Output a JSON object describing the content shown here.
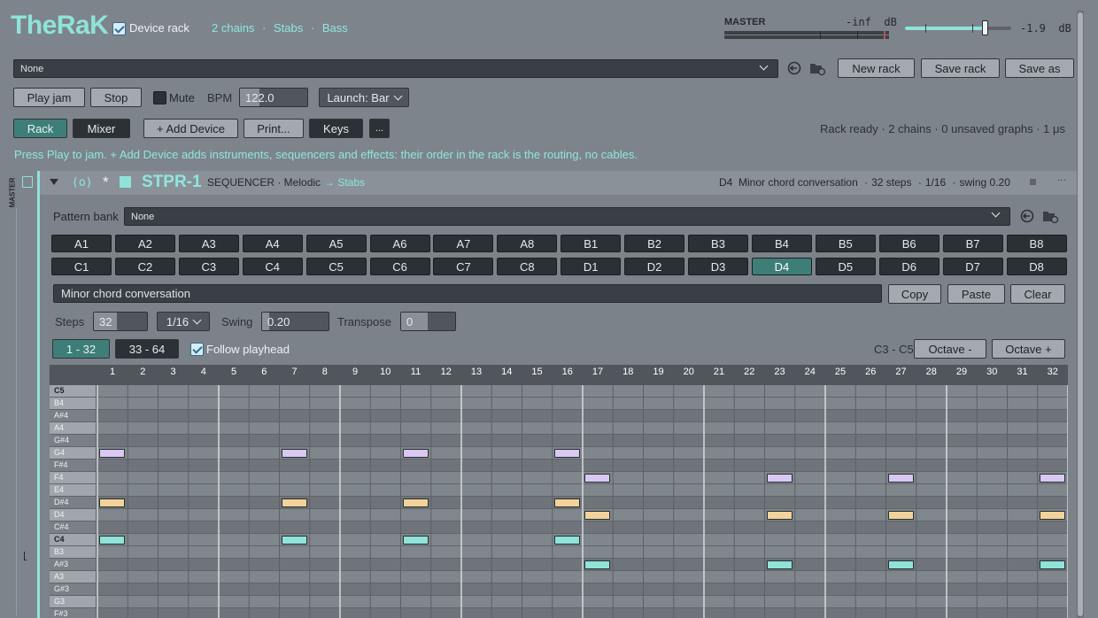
{
  "app": {
    "logo": "TheRaK",
    "device_rack_label": "Device rack",
    "device_rack_checked": true,
    "breadcrumb": [
      "2 chains",
      "Stabs",
      "Bass"
    ],
    "breadcrumb_sep": "·"
  },
  "master": {
    "label": "MASTER",
    "level_text": "-inf  dB",
    "volume_text": "-1.9  dB",
    "volume_level": 0.75
  },
  "rack_bar": {
    "preset_value": "None",
    "new_rack": "New rack",
    "save_rack": "Save rack",
    "save_as": "Save as"
  },
  "transport": {
    "play": "Play jam",
    "stop": "Stop",
    "mute": "Mute",
    "bpm_label": "BPM",
    "bpm_value": "122.0",
    "launch": "Launch: Bar"
  },
  "toolbar": {
    "rack": "Rack",
    "mixer": "Mixer",
    "add_device": "+ Add Device",
    "print": "Print...",
    "keys": "Keys",
    "more": "...",
    "status": "Rack ready · 2 chains · 0 unsaved graphs · 1 μs"
  },
  "hint": "Press Play to jam. + Add Device adds instruments, sequencers and effects: their order in the rack is the routing, no cables.",
  "side": {
    "master_vertical": "MASTER"
  },
  "device": {
    "toggle": "(o)",
    "star": "*",
    "name": "STPR-1",
    "type": "SEQUENCER · Melodic",
    "route": "→ Stabs",
    "summary_pattern": "D4",
    "summary_name": "Minor chord conversation",
    "summary_steps": "32 steps",
    "summary_rate": "1/16",
    "summary_swing": "swing 0.20",
    "menu": "···"
  },
  "pattern_bank": {
    "label": "Pattern bank",
    "value": "None",
    "row1": [
      "A1",
      "A2",
      "A3",
      "A4",
      "A5",
      "A6",
      "A7",
      "A8",
      "B1",
      "B2",
      "B3",
      "B4",
      "B5",
      "B6",
      "B7",
      "B8"
    ],
    "row2": [
      "C1",
      "C2",
      "C3",
      "C4",
      "C5",
      "C6",
      "C7",
      "C8",
      "D1",
      "D2",
      "D3",
      "D4",
      "D5",
      "D6",
      "D7",
      "D8"
    ],
    "selected": "D4"
  },
  "pattern_name": {
    "value": "Minor chord conversation",
    "copy": "Copy",
    "paste": "Paste",
    "clear": "Clear"
  },
  "params": {
    "steps_label": "Steps",
    "steps_value": "32",
    "rate_value": "1/16",
    "swing_label": "Swing",
    "swing_value": "0.20",
    "transpose_label": "Transpose",
    "transpose_value": "0"
  },
  "pages": {
    "page1": "1 - 32",
    "page2": "33 - 64",
    "follow": "Follow playhead",
    "follow_checked": true,
    "range": "C3 - C5",
    "octave_down": "Octave -",
    "octave_up": "Octave +"
  },
  "roll": {
    "steps": [
      "1",
      "2",
      "3",
      "4",
      "5",
      "6",
      "7",
      "8",
      "9",
      "10",
      "11",
      "12",
      "13",
      "14",
      "15",
      "16",
      "17",
      "18",
      "19",
      "20",
      "21",
      "22",
      "23",
      "24",
      "25",
      "26",
      "27",
      "28",
      "29",
      "30",
      "31",
      "32"
    ],
    "rows": [
      "C5",
      "B4",
      "A#4",
      "A4",
      "G#4",
      "G4",
      "F#4",
      "F4",
      "E4",
      "D#4",
      "D4",
      "C#4",
      "C4",
      "B3",
      "A#3",
      "A3",
      "G#3",
      "G3",
      "F#3"
    ],
    "notes": [
      {
        "pitch": "G4",
        "step": 1
      },
      {
        "pitch": "D#4",
        "step": 1
      },
      {
        "pitch": "C4",
        "step": 1
      },
      {
        "pitch": "G4",
        "step": 7
      },
      {
        "pitch": "D#4",
        "step": 7
      },
      {
        "pitch": "C4",
        "step": 7
      },
      {
        "pitch": "G4",
        "step": 11
      },
      {
        "pitch": "D#4",
        "step": 11
      },
      {
        "pitch": "C4",
        "step": 11
      },
      {
        "pitch": "G4",
        "step": 16
      },
      {
        "pitch": "D#4",
        "step": 16
      },
      {
        "pitch": "C4",
        "step": 16
      },
      {
        "pitch": "F4",
        "step": 17
      },
      {
        "pitch": "D4",
        "step": 17
      },
      {
        "pitch": "A#3",
        "step": 17
      },
      {
        "pitch": "F4",
        "step": 23
      },
      {
        "pitch": "D4",
        "step": 23
      },
      {
        "pitch": "A#3",
        "step": 23
      },
      {
        "pitch": "F4",
        "step": 27
      },
      {
        "pitch": "D4",
        "step": 27
      },
      {
        "pitch": "A#3",
        "step": 27
      },
      {
        "pitch": "F4",
        "step": 32
      },
      {
        "pitch": "D4",
        "step": 32
      },
      {
        "pitch": "A#3",
        "step": 32
      }
    ],
    "note_colors": {
      "G4": "#d9c8f2",
      "F4": "#d9c8f2",
      "D#4": "#f3d39a",
      "D4": "#f3d39a",
      "C4": "#8fe3d9",
      "A#3": "#8fe3d9"
    }
  }
}
